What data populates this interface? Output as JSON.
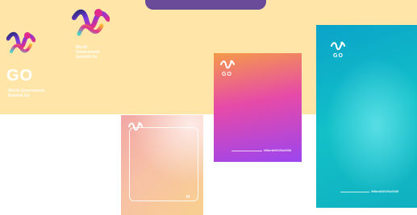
{
  "colors": {
    "yellow": "#FFE6A8",
    "purple": "#6A4B9A",
    "peach1": "#F2A7A6",
    "peach2": "#F7C1A6",
    "peach3": "#F8D08E",
    "orange": "#F59A4A",
    "pink": "#E64AA8",
    "violet": "#9B45F0",
    "teal1": "#0AA3C9",
    "teal2": "#12C0C8",
    "teal3": "#10B0C0",
    "ribbon1": "#2A2A7A",
    "ribbon2": "#7B3BE3",
    "ribbon3": "#E02A8E",
    "ribbon4": "#F6B12A",
    "ribbon5": "#45D0C8"
  },
  "brand": {
    "go": "GO",
    "caption_small": "World Government Summit Go",
    "caption_large": "World Government Summit Go"
  },
  "cards": {
    "purple": {
      "go": "GO",
      "footer": "#WorldGOGo2026"
    },
    "teal": {
      "go": "GO",
      "footer": "#WorldGOGo2026"
    },
    "pink": {
      "quote": "”"
    }
  },
  "icons": {
    "logo": "ribbon-w-logo",
    "quote": "quote-icon"
  }
}
